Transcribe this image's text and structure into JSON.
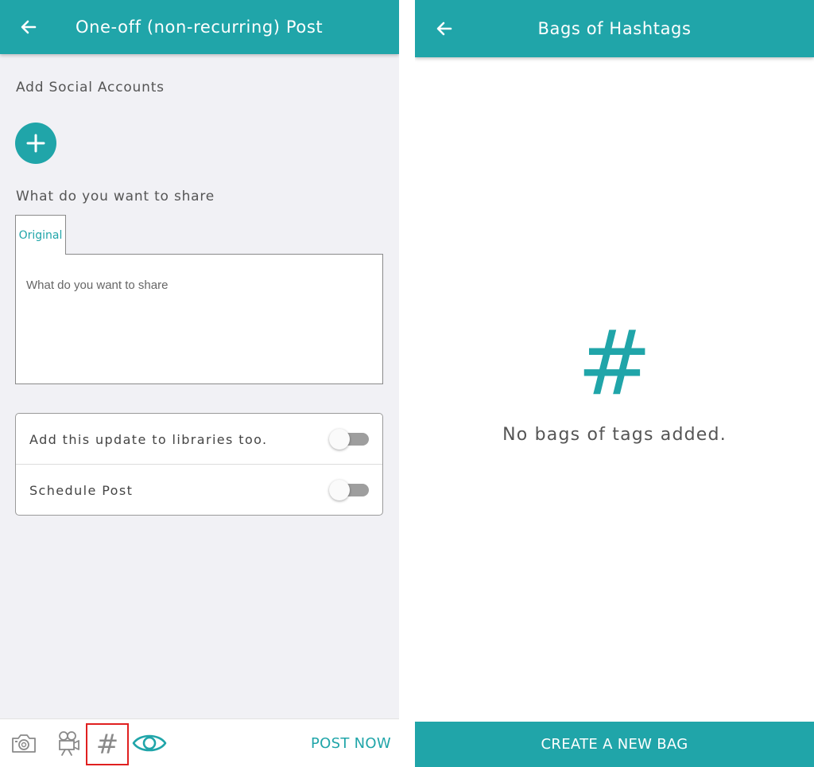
{
  "left_screen": {
    "header": {
      "back_icon": "arrow-left-icon",
      "title": "One-off (non-recurring) Post"
    },
    "social_accounts": {
      "label": "Add Social Accounts",
      "add_icon": "plus-icon"
    },
    "share": {
      "label": "What do you want to share",
      "tab_label": "Original",
      "placeholder": "What do you want to share",
      "value": ""
    },
    "options": [
      {
        "label": "Add this update to libraries too.",
        "enabled": false
      },
      {
        "label": "Schedule Post",
        "enabled": false
      }
    ],
    "toolbar": {
      "icons": [
        "camera-icon",
        "video-camera-icon",
        "hashtag-icon",
        "eye-icon"
      ],
      "hashtag_glyph": "#",
      "post_now_label": "POST NOW"
    }
  },
  "right_screen": {
    "header": {
      "back_icon": "arrow-left-icon",
      "title": "Bags of Hashtags"
    },
    "empty_state": {
      "icon_glyph": "#",
      "message": "No bags of tags added."
    },
    "create_button_label": "CREATE A NEW BAG"
  },
  "colors": {
    "primary": "#20a5a9",
    "highlight_box": "#e02020",
    "left_background": "#f1f1f5"
  }
}
